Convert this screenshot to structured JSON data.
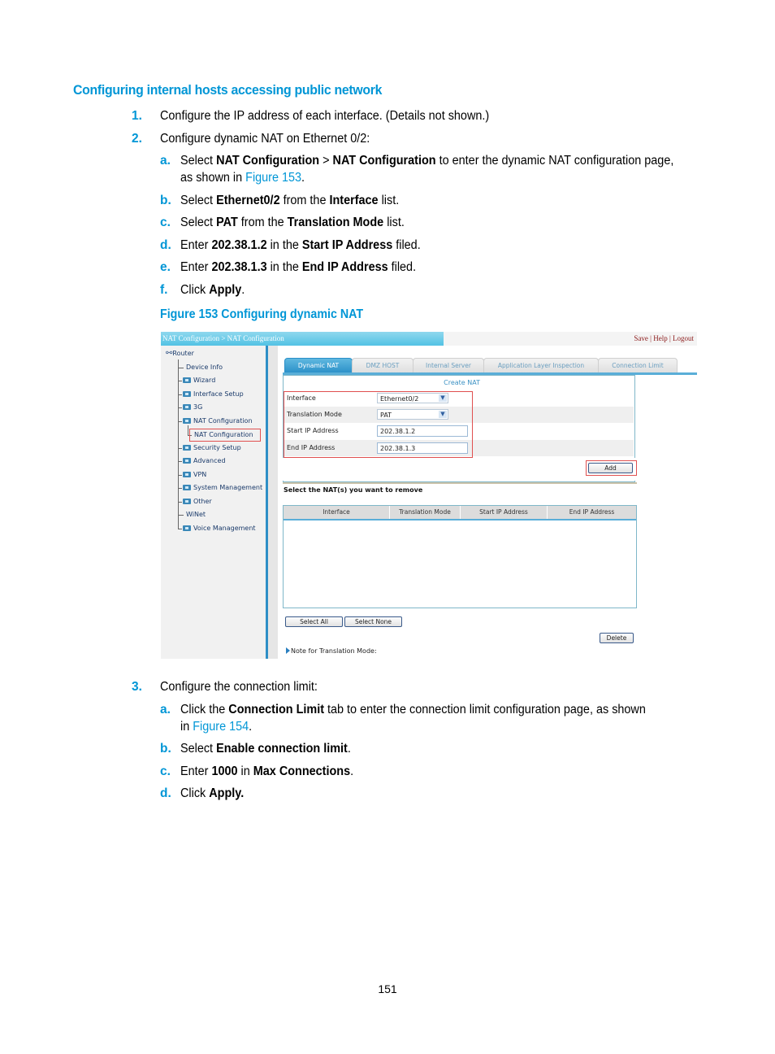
{
  "heading": "Configuring internal hosts accessing public network",
  "steps": [
    {
      "num": "1.",
      "text": "Configure the IP address of each interface. (Details not shown.)"
    },
    {
      "num": "2.",
      "text": "Configure dynamic NAT on Ethernet 0/2:"
    }
  ],
  "substeps_2": {
    "a": {
      "label": "a.",
      "t1": "Select ",
      "b1": "NAT Configuration",
      "t2": " > ",
      "b2": "NAT Configuration",
      "t3": " to enter the dynamic NAT configuration page,",
      "t4": "as shown in ",
      "link": "Figure 153",
      "t5": "."
    },
    "b": {
      "label": "b.",
      "t1": "Select ",
      "b1": "Ethernet0/2",
      "t2": " from the ",
      "b2": "Interface",
      "t3": " list."
    },
    "c": {
      "label": "c.",
      "t1": "Select ",
      "b1": "PAT",
      "t2": " from the ",
      "b2": "Translation Mode",
      "t3": " list."
    },
    "d": {
      "label": "d.",
      "t1": "Enter ",
      "b1": "202.38.1.2",
      "t2": " in the ",
      "b2": "Start IP Address",
      "t3": " filed."
    },
    "e": {
      "label": "e.",
      "t1": "Enter ",
      "b1": "202.38.1.3",
      "t2": " in the ",
      "b2": "End IP Address",
      "t3": " filed."
    },
    "f": {
      "label": "f.",
      "t1": "Click ",
      "b1": "Apply",
      "t2": "."
    }
  },
  "figure_caption": "Figure 153 Configuring dynamic NAT",
  "figure": {
    "breadcrumb": "NAT Configuration > NAT Configuration",
    "top_links": "Save | Help | Logout",
    "tree_root": "Router",
    "tree_items": [
      "Device Info",
      "Wizard",
      "Interface Setup",
      "3G",
      "NAT Configuration",
      "NAT Configuration",
      "Security Setup",
      "Advanced",
      "VPN",
      "System Management",
      "Other",
      "WiNet",
      "Voice Management"
    ],
    "tabs": [
      "Dynamic NAT",
      "DMZ HOST",
      "Internal Server",
      "Application Layer Inspection",
      "Connection Limit"
    ],
    "active_tab": "Dynamic NAT",
    "panel_title": "Create NAT",
    "fields": {
      "interface_label": "Interface",
      "interface_value": "Ethernet0/2",
      "mode_label": "Translation Mode",
      "mode_value": "PAT",
      "start_label": "Start IP Address",
      "start_value": "202.38.1.2",
      "end_label": "End IP Address",
      "end_value": "202.38.1.3"
    },
    "add_button": "Add",
    "remove_label": "Select the NAT(s) you want to remove",
    "table_headers": [
      "Interface",
      "Translation Mode",
      "Start IP Address",
      "End IP Address"
    ],
    "select_all": "Select All",
    "select_none": "Select None",
    "delete_button": "Delete",
    "note": "Note for Translation Mode:"
  },
  "step3": {
    "num": "3.",
    "text": "Configure the connection limit:"
  },
  "substeps_3": {
    "a": {
      "label": "a.",
      "t1": "Click the ",
      "b1": "Connection Limit",
      "t2": " tab to enter the connection limit configuration page, as shown",
      "t3": "in ",
      "link": "Figure 154",
      "t4": "."
    },
    "b": {
      "label": "b.",
      "t1": "Select ",
      "b1": "Enable connection limit",
      "t2": "."
    },
    "c": {
      "label": "c.",
      "t1": "Enter ",
      "b1": "1000",
      "t2": " in ",
      "b2": "Max Connections",
      "t3": "."
    },
    "d": {
      "label": "d.",
      "t1": "Click ",
      "b1": "Apply."
    }
  },
  "page_number": "151"
}
